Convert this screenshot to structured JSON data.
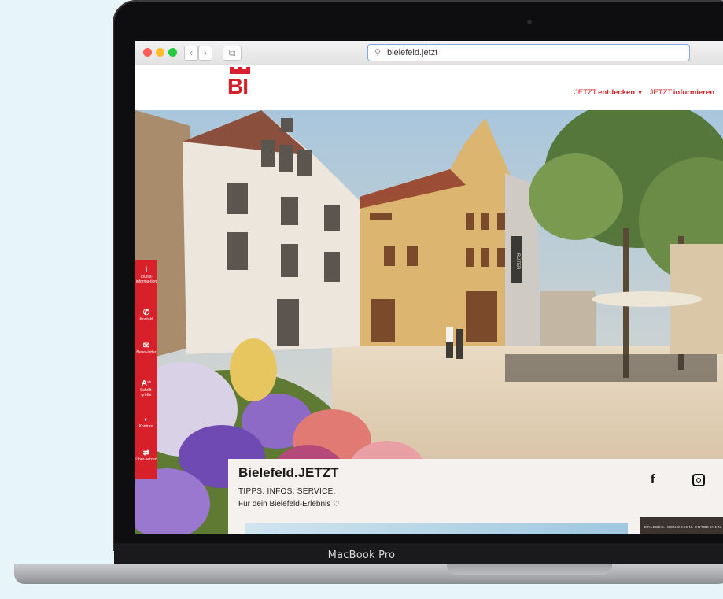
{
  "device": {
    "label": "MacBook Pro"
  },
  "browser": {
    "url": "bielefeld.jetzt",
    "nav_back": "‹",
    "nav_forward": "›",
    "sidebar_toggle": "⧉",
    "traffic_lights": {
      "close": "#ff5f57",
      "minimize": "#febc2e",
      "zoom": "#28c840"
    }
  },
  "site": {
    "logo_text": "BI",
    "brand_color": "#d8202a",
    "nav": [
      {
        "prefix": "JETZT.",
        "label": "entdecken",
        "caret": "▼"
      },
      {
        "prefix": "JETZT.",
        "label": "informieren"
      }
    ]
  },
  "accessibility_bar": [
    {
      "icon": "i",
      "label": "Tourist-informa-tion"
    },
    {
      "icon": "✆",
      "label": "Kontakt"
    },
    {
      "icon": "✉",
      "label": "News-letter"
    },
    {
      "icon": "A⁺",
      "label": "Schrift-größe"
    },
    {
      "icon": "◐",
      "label": "Kontrast"
    },
    {
      "icon": "⇄",
      "label": "Über-setzen"
    }
  ],
  "hero": {
    "sign_text": "RÜTER"
  },
  "info_card": {
    "title": "Bielefeld.JETZT",
    "tagline": "TIPPS. INFOS. SERVICE.",
    "subtitle": "Für dein Bielefeld-Erlebnis ♡",
    "social": {
      "facebook": "f",
      "instagram": "instagram-icon"
    },
    "teaser_text": "ERLEBEN. GENIESSEN. ENTDECKEN."
  }
}
